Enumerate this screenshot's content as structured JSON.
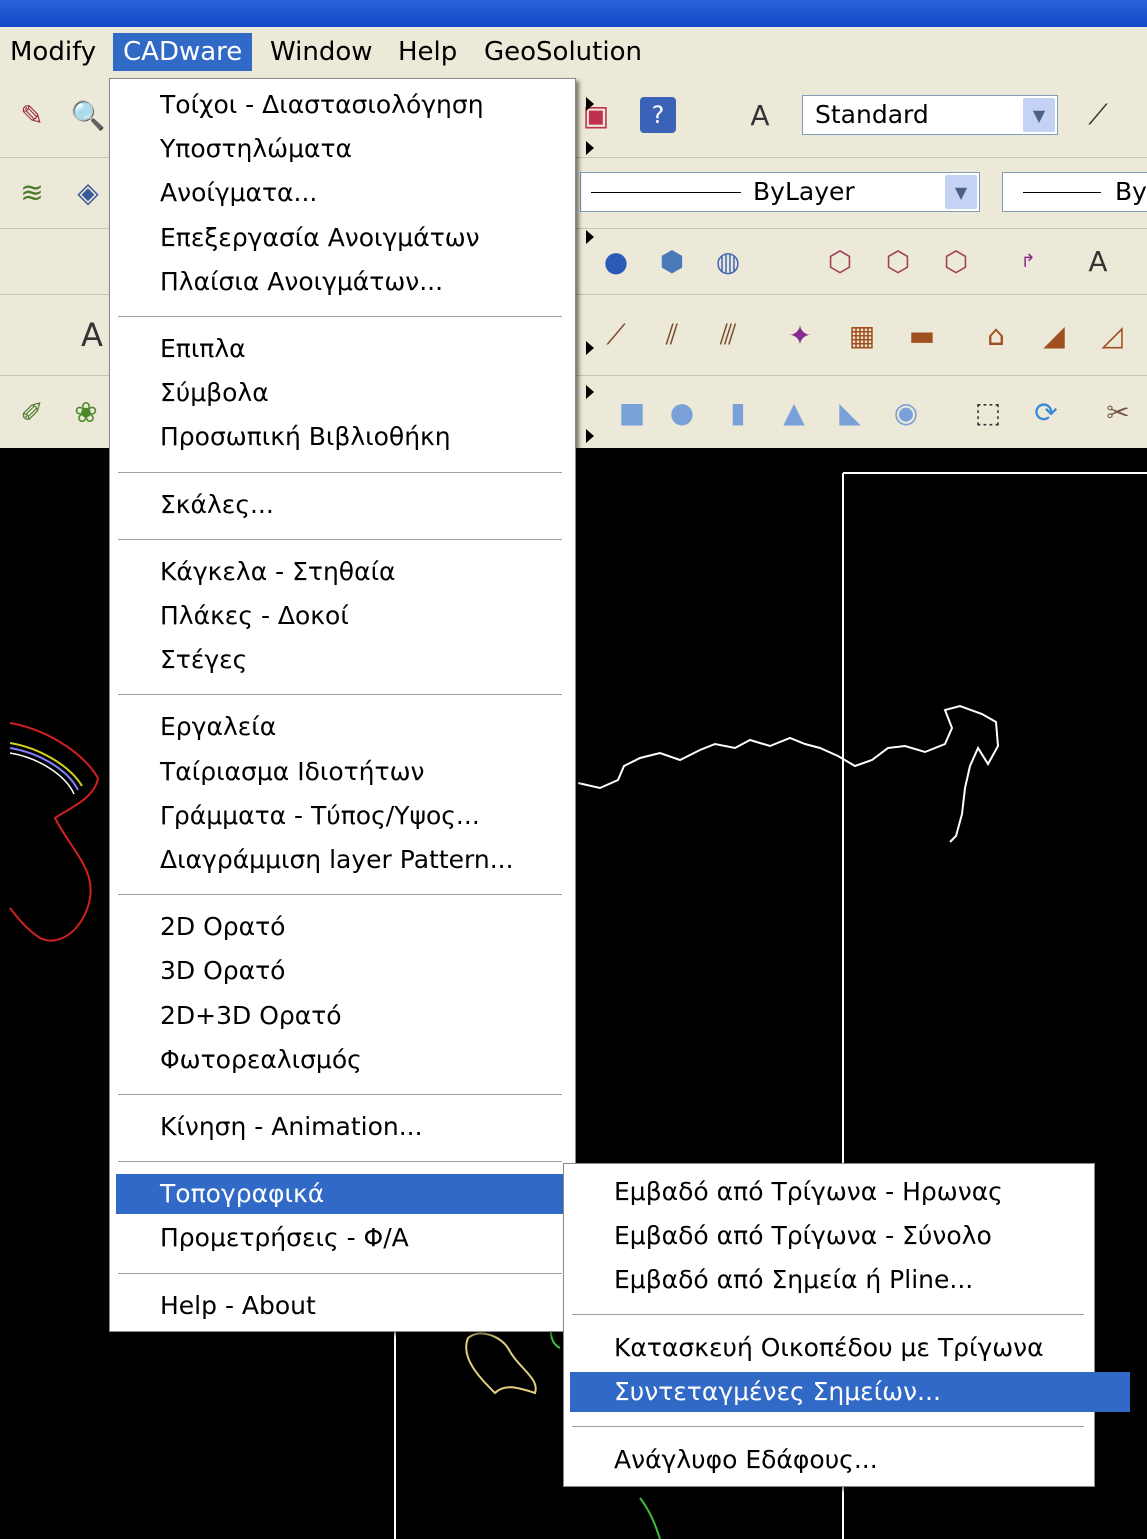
{
  "menubar": {
    "items": [
      {
        "label": "Modify",
        "active": false
      },
      {
        "label": "CADware",
        "active": true
      },
      {
        "label": "Window",
        "active": false
      },
      {
        "label": "Help",
        "active": false
      },
      {
        "label": "GeoSolution",
        "active": false
      }
    ]
  },
  "toolbars": {
    "text_style": "Standard",
    "linetype": "ByLayer",
    "lineweight_partial": "By",
    "style_a": "A"
  },
  "cadware_menu": {
    "groups": [
      [
        {
          "label": "Τοίχοι - Διαστασιολόγηση",
          "submenu": true
        },
        {
          "label": "Υποστηλώματα",
          "submenu": true
        },
        {
          "label": "Ανοίγματα...",
          "submenu": false
        },
        {
          "label": "Επεξεργασία Ανοιγμάτων",
          "submenu": true
        },
        {
          "label": "Πλαίσια Ανοιγμάτων...",
          "submenu": false
        }
      ],
      [
        {
          "label": "Επιπλα",
          "submenu": true
        },
        {
          "label": "Σύμβολα",
          "submenu": true
        },
        {
          "label": "Προσωπική Βιβλιοθήκη",
          "submenu": true
        }
      ],
      [
        {
          "label": "Σκάλες...",
          "submenu": false
        }
      ],
      [
        {
          "label": "Κάγκελα - Στηθαία",
          "submenu": true
        },
        {
          "label": "Πλάκες - Δοκοί",
          "submenu": true
        },
        {
          "label": "Στέγες",
          "submenu": true
        }
      ],
      [
        {
          "label": "Εργαλεία",
          "submenu": true
        },
        {
          "label": "Ταίριασμα Ιδιοτήτων",
          "submenu": false
        },
        {
          "label": "Γράμματα - Τύπος/Υψος...",
          "submenu": false
        },
        {
          "label": "Διαγράμμιση layer Pattern...",
          "submenu": false
        }
      ],
      [
        {
          "label": "2D Ορατό",
          "submenu": false
        },
        {
          "label": "3D Ορατό",
          "submenu": false
        },
        {
          "label": "2D+3D Ορατό",
          "submenu": false
        },
        {
          "label": "Φωτορεαλισμός",
          "submenu": true
        }
      ],
      [
        {
          "label": "Κίνηση - Animation...",
          "submenu": false
        }
      ],
      [
        {
          "label": "Τοπογραφικά",
          "submenu": true,
          "highlighted": true
        },
        {
          "label": "Προμετρήσεις - Φ/Α",
          "submenu": true
        }
      ],
      [
        {
          "label": "Help - About",
          "submenu": true
        }
      ]
    ]
  },
  "topo_submenu": {
    "groups": [
      [
        {
          "label": "Εμβαδό από Τρίγωνα - Ηρωνας"
        },
        {
          "label": "Εμβαδό από Τρίγωνα - Σύνολο"
        },
        {
          "label": "Εμβαδό από Σημεία ή Pline..."
        }
      ],
      [
        {
          "label": "Κατασκευή Οικοπέδου με Τρίγωνα"
        },
        {
          "label": "Συντεταγμένες Σημείων...",
          "highlighted": true
        }
      ],
      [
        {
          "label": "Ανάγλυφο Εδάφους..."
        }
      ]
    ]
  },
  "colors": {
    "menu_highlight": "#3169c6",
    "toolbar_bg": "#ece9d8",
    "drawing_bg": "#000000"
  }
}
